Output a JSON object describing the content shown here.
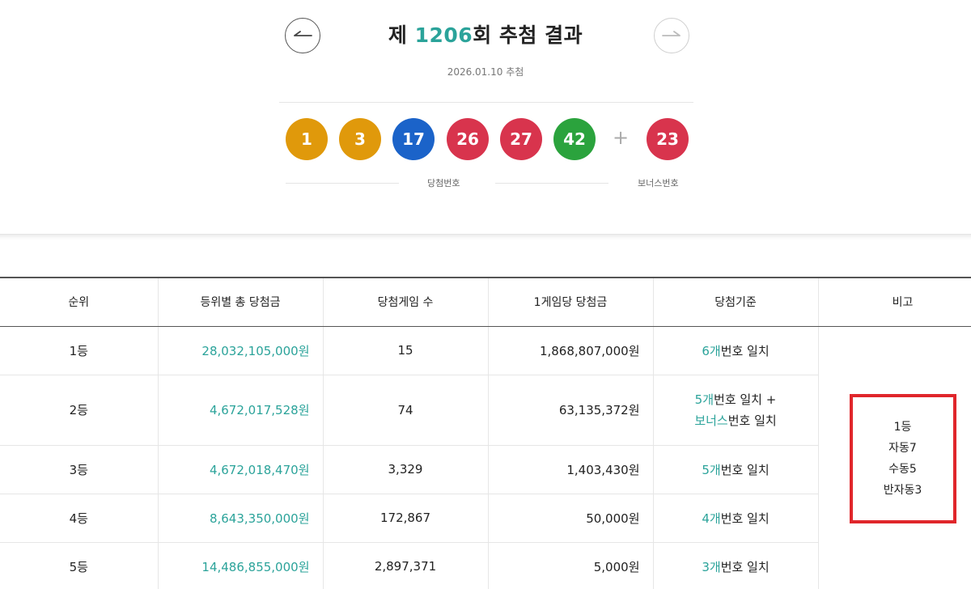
{
  "header": {
    "title_prefix": "제 ",
    "round_number": "1206",
    "title_suffix": "회 추첨 결과",
    "draw_date": "2026.01.10 추첨"
  },
  "winning_numbers": [
    {
      "value": "1",
      "color": "#e0990b"
    },
    {
      "value": "3",
      "color": "#e0990b"
    },
    {
      "value": "17",
      "color": "#1b63c9"
    },
    {
      "value": "26",
      "color": "#d8344d"
    },
    {
      "value": "27",
      "color": "#d8344d"
    },
    {
      "value": "42",
      "color": "#2ba33d"
    }
  ],
  "bonus_number": {
    "value": "23",
    "color": "#d8344d"
  },
  "plus_sign": "+",
  "labels": {
    "winning": "당첨번호",
    "bonus": "보너스번호"
  },
  "table": {
    "headers": [
      "순위",
      "등위별 총 당첨금",
      "당첨게임 수",
      "1게임당 당첨금",
      "당첨기준",
      "비고"
    ],
    "rows": [
      {
        "rank": "1등",
        "total": "28,032,105,000원",
        "games": "15",
        "per_game": "1,868,807,000원",
        "criteria_num": "6개",
        "criteria_text": "번호 일치"
      },
      {
        "rank": "2등",
        "total": "4,672,017,528원",
        "games": "74",
        "per_game": "63,135,372원",
        "criteria_num": "5개",
        "criteria_text": "번호 일치 +",
        "criteria_bonus": "보너스",
        "criteria_bonus_text": "번호 일치"
      },
      {
        "rank": "3등",
        "total": "4,672,018,470원",
        "games": "3,329",
        "per_game": "1,403,430원",
        "criteria_num": "5개",
        "criteria_text": "번호 일치"
      },
      {
        "rank": "4등",
        "total": "8,643,350,000원",
        "games": "172,867",
        "per_game": "50,000원",
        "criteria_num": "4개",
        "criteria_text": "번호 일치"
      },
      {
        "rank": "5등",
        "total": "14,486,855,000원",
        "games": "2,897,371",
        "per_game": "5,000원",
        "criteria_num": "3개",
        "criteria_text": "번호 일치"
      }
    ],
    "note_lines": [
      "1등",
      "자동7",
      "수동5",
      "반자동3"
    ]
  },
  "colors": {
    "accent_green": "#2ba39a",
    "highlight_red": "#e0262b"
  }
}
